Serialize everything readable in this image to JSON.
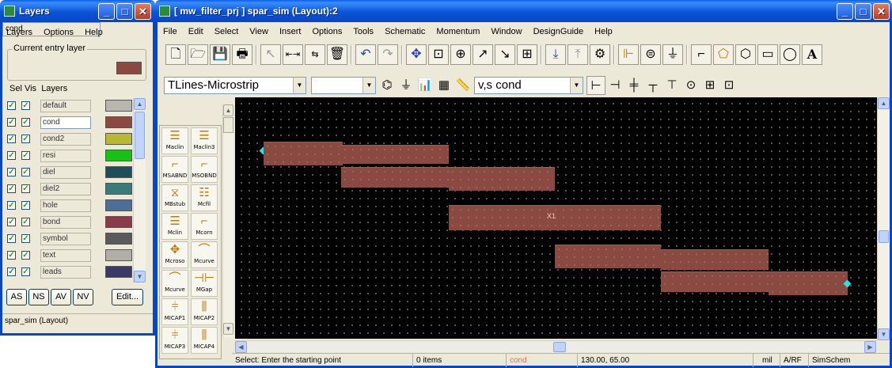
{
  "layers_window": {
    "title": "Layers",
    "menu": [
      "Layers",
      "Options",
      "Help"
    ],
    "current_entry_label": "Current entry layer",
    "current_entry_value": "cond",
    "current_entry_color": "#8a4a42",
    "header_sel": "Sel",
    "header_vis": "Vis",
    "header_layers": "Layers",
    "layers": [
      {
        "name": "default",
        "sel": true,
        "vis": true,
        "color": "#b8b6ae"
      },
      {
        "name": "cond",
        "sel": true,
        "vis": true,
        "color": "#8a4a42"
      },
      {
        "name": "cond2",
        "sel": true,
        "vis": true,
        "color": "#b8b832"
      },
      {
        "name": "resi",
        "sel": true,
        "vis": true,
        "color": "#18c018"
      },
      {
        "name": "diel",
        "sel": true,
        "vis": true,
        "color": "#1d4e5a"
      },
      {
        "name": "diel2",
        "sel": true,
        "vis": true,
        "color": "#3a7a7a"
      },
      {
        "name": "hole",
        "sel": true,
        "vis": true,
        "color": "#4c6f9a"
      },
      {
        "name": "bond",
        "sel": true,
        "vis": true,
        "color": "#8a3a4a"
      },
      {
        "name": "symbol",
        "sel": true,
        "vis": true,
        "color": "#5a5a5a"
      },
      {
        "name": "text",
        "sel": true,
        "vis": true,
        "color": "#b0aea6"
      },
      {
        "name": "leads",
        "sel": true,
        "vis": true,
        "color": "#3a3a6a"
      }
    ],
    "buttons": [
      "AS",
      "NS",
      "AV",
      "NV",
      "Edit..."
    ],
    "status": "spar_sim (Layout)"
  },
  "main_window": {
    "title": "[ mw_filter_prj ] spar_sim (Layout):2",
    "menu": [
      "File",
      "Edit",
      "Select",
      "View",
      "Insert",
      "Options",
      "Tools",
      "Schematic",
      "Momentum",
      "Window",
      "DesignGuide",
      "Help"
    ],
    "palette_combo": "TLines-Microstrip",
    "component_combo": "",
    "snap_combo": "v,s cond",
    "palette_items": [
      {
        "label": "Maclin",
        "icon": "maclin-icon"
      },
      {
        "label": "Maclin3",
        "icon": "maclin3-icon"
      },
      {
        "label": "MSABND",
        "icon": "msabnd-icon"
      },
      {
        "label": "MSOBND",
        "icon": "msobnd-icon"
      },
      {
        "label": "MBstub",
        "icon": "mbstub-icon"
      },
      {
        "label": "Mcfil",
        "icon": "mcfil-icon"
      },
      {
        "label": "Mclin",
        "icon": "mclin-icon"
      },
      {
        "label": "Mcorn",
        "icon": "mcorn-icon"
      },
      {
        "label": "Mcroso",
        "icon": "mcroso-icon"
      },
      {
        "label": "Mcurve",
        "icon": "mcurve-icon"
      },
      {
        "label": "Mcurve",
        "icon": "mcurve2-icon"
      },
      {
        "label": "MGap",
        "icon": "mgap-icon"
      },
      {
        "label": "MICAP1",
        "icon": "micap1-icon"
      },
      {
        "label": "MICAP2",
        "icon": "micap2-icon"
      },
      {
        "label": "MICAP3",
        "icon": "micap3-icon"
      },
      {
        "label": "MICAP4",
        "icon": "micap4-icon"
      }
    ],
    "canvas_marker": "X1",
    "status": {
      "prompt": "Select: Enter the starting point",
      "items": "0 items",
      "layer": "cond",
      "layer_color": "#e07050",
      "coords": "130.00, 65.00",
      "units": "mil",
      "mode": "A/RF",
      "sim": "SimSchem"
    }
  }
}
